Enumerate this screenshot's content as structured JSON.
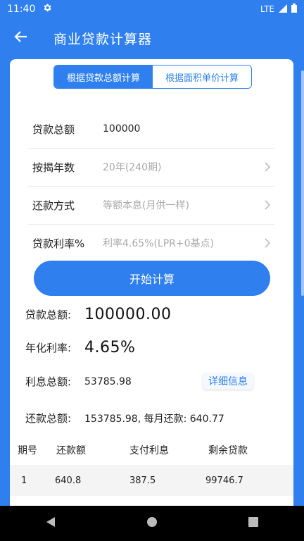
{
  "status": {
    "time": "11:40",
    "network": "LTE"
  },
  "appbar": {
    "title": "商业贷款计算器"
  },
  "tabs": [
    {
      "label": "根据贷款总额计算",
      "active": true
    },
    {
      "label": "根据面积单价计算",
      "active": false
    }
  ],
  "form": {
    "loan_amount": {
      "label": "贷款总额",
      "value": "100000"
    },
    "years": {
      "label": "按揭年数",
      "placeholder": "20年(240期)"
    },
    "method": {
      "label": "还款方式",
      "placeholder": "等额本息(月供一样)"
    },
    "rate": {
      "label": "贷款利率%",
      "placeholder": "利率4.65%(LPR+0基点)"
    }
  },
  "start_button": "开始计算",
  "results": {
    "total_loan": {
      "label": "贷款总额:",
      "value": "100000.00"
    },
    "annual_rate": {
      "label": "年化利率:",
      "value": "4.65%"
    },
    "total_interest": {
      "label": "利息总额:",
      "value": "53785.98"
    },
    "detail_button": "详细信息",
    "total_repay": {
      "label": "还款总额:",
      "value": "153785.98, 每月还款: 640.77"
    }
  },
  "table": {
    "headers": [
      "期号",
      "还款额",
      "支付利息",
      "剩余贷款"
    ],
    "rows": [
      [
        "1",
        "640.8",
        "387.5",
        "99746.7"
      ]
    ]
  },
  "colors": {
    "primary": "#2f80ee"
  }
}
